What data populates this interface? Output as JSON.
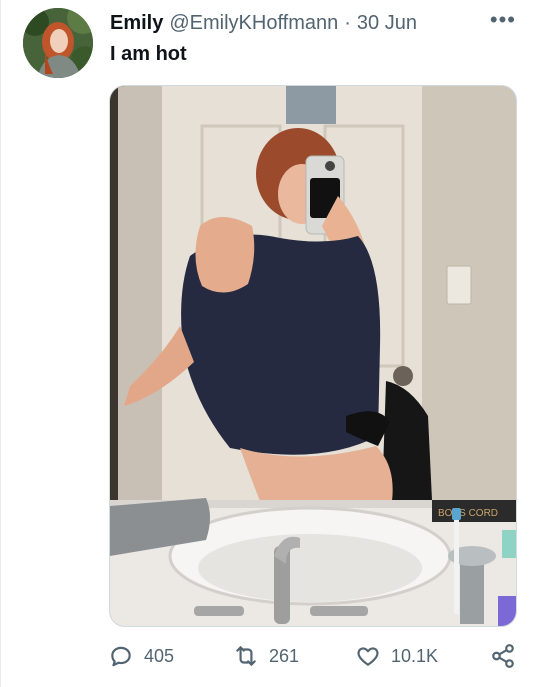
{
  "tweet": {
    "author_name": "Emily",
    "author_handle": "@EmilyKHoffmann",
    "separator": "·",
    "date": "30 Jun",
    "text": "I am hot",
    "more_icon": "more-horizontal-icon"
  },
  "media": {
    "type": "photo",
    "box_label": "BOSS CORD"
  },
  "actions": {
    "reply_count": "405",
    "retweet_count": "261",
    "like_count": "10.1K",
    "reply_icon": "reply-icon",
    "retweet_icon": "retweet-icon",
    "like_icon": "heart-icon",
    "share_icon": "share-icon"
  },
  "colors": {
    "text_primary": "#0f1419",
    "text_secondary": "#536471",
    "border": "#cfd9de"
  }
}
